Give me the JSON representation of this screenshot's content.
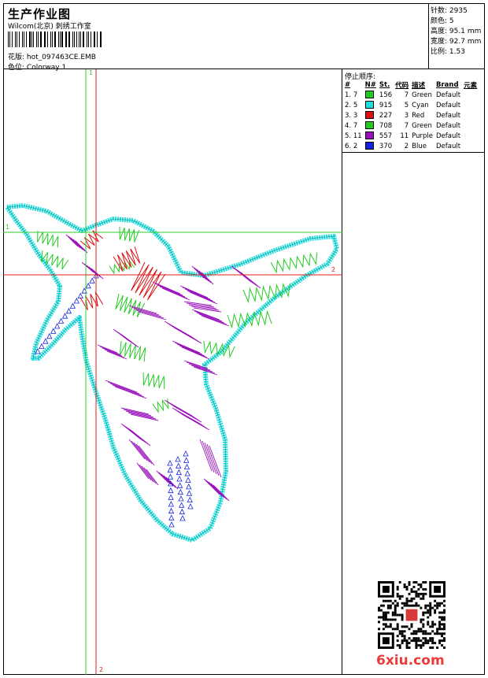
{
  "header": {
    "title": "生产作业图",
    "subtitle": "Wilcom(北京) 刺绣工作室",
    "file_label": "花版:",
    "file_name": "hot_097463CE.EMB",
    "colorway_label": "色位:",
    "colorway_value": "Colorway 1"
  },
  "stats": [
    {
      "label": "针数:",
      "value": "2935"
    },
    {
      "label": "颜色:",
      "value": "5"
    },
    {
      "label": "高度:",
      "value": "95.1 mm"
    },
    {
      "label": "宽度:",
      "value": "92.7 mm"
    },
    {
      "label": "比例:",
      "value": "1.53"
    }
  ],
  "stop_sequence": {
    "title": "停止顺序:",
    "headers": [
      "#",
      "N#",
      "St.",
      "代码",
      "描述",
      "Brand",
      "元素"
    ],
    "rows": [
      {
        "idx": "1.",
        "needle": "7",
        "color": "#22cc22",
        "stitches": "156",
        "code": "7",
        "desc": "Green",
        "brand": "Default"
      },
      {
        "idx": "2.",
        "needle": "5",
        "color": "#22dddd",
        "stitches": "915",
        "code": "5",
        "desc": "Cyan",
        "brand": "Default"
      },
      {
        "idx": "3.",
        "needle": "3",
        "color": "#dd1111",
        "stitches": "227",
        "code": "3",
        "desc": "Red",
        "brand": "Default"
      },
      {
        "idx": "4.",
        "needle": "7",
        "color": "#22cc22",
        "stitches": "708",
        "code": "7",
        "desc": "Green",
        "brand": "Default"
      },
      {
        "idx": "5.",
        "needle": "11",
        "color": "#9911bb",
        "stitches": "557",
        "code": "11",
        "desc": "Purple",
        "brand": "Default"
      },
      {
        "idx": "6.",
        "needle": "2",
        "color": "#1122dd",
        "stitches": "370",
        "code": "2",
        "desc": "Blue",
        "brand": "Default"
      }
    ]
  },
  "guides": {
    "v1": "1",
    "v2": "2",
    "h1": "1",
    "h2": "2"
  },
  "watermark": "6xiu.com",
  "colors": {
    "cyan": "#22dddd",
    "green": "#22cc22",
    "red": "#dd1111",
    "purple": "#9911bb",
    "blue": "#1122dd",
    "guide_green": "#2ecc2e",
    "guide_red": "#e01b1b"
  }
}
